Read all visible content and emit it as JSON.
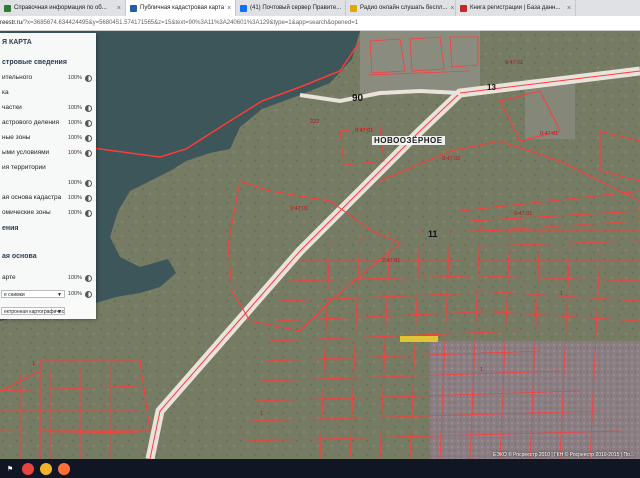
{
  "browser": {
    "tabs": [
      {
        "label": "Справочная информация по об...",
        "active": false,
        "color": "#2e7d32"
      },
      {
        "label": "Публичная кадастровая карта",
        "active": true,
        "color": "#1f5fa8"
      },
      {
        "label": "(41) Почтовый сервер Правите...",
        "active": false,
        "color": "#0d6efd"
      },
      {
        "label": "Радио онлайн слушать беспл...",
        "active": false,
        "color": "#e0a800"
      },
      {
        "label": "Книга регистрации | База данн...",
        "active": false,
        "color": "#c62828"
      }
    ],
    "url_host": "reestr.ru",
    "url_rest": "/?x=3685674.634424495&y=5680451.574171565&z=15&text=90%3A11%3A240601%3A129&type=1&app=search&opened=1"
  },
  "panel": {
    "title": "Я КАРТА",
    "section1": "стровые сведения",
    "layers1": [
      {
        "label": "ительного",
        "value": "100%"
      },
      {
        "label": "ка",
        "value": ""
      },
      {
        "label": "частки",
        "value": "100%"
      },
      {
        "label": "астрового деления",
        "value": "100%"
      },
      {
        "label": "ные зоны",
        "value": "100%"
      },
      {
        "label": "ыми условиями",
        "value": "100%"
      },
      {
        "label": "ия территории",
        "value": ""
      },
      {
        "label": "",
        "value": "100%"
      },
      {
        "label": "ая основа кадастра",
        "value": "100%"
      },
      {
        "label": "омические зоны",
        "value": "100%"
      }
    ],
    "section1_tail": "ения",
    "section2": "ая основа",
    "layers2": [
      {
        "label": "арте",
        "value": "100%"
      }
    ],
    "select1": "е снимки",
    "select1_value": "100%",
    "select2": "ектронная картографичес"
  },
  "map": {
    "village": "НОВООЗЁРНОЕ",
    "road_90": "90",
    "road_13": "13",
    "block_11": "11",
    "parcel_labels": [
      "0:47:01",
      "0:47:02",
      "0:47:01",
      "0:47:01",
      "2:47:01",
      "0:47:01",
      "0:47:01",
      "222",
      "1",
      "1",
      "1",
      "1"
    ],
    "copyright": "ЕЭКО © Росреестр 2010 | ГКН © Росреестр 2010-2015 | По...",
    "colors": {
      "water": "#3d5659",
      "land": "#747a62",
      "parcel": "#ff3b3b",
      "road": "#eae3dc",
      "highlight": "#e0c534"
    }
  },
  "taskbar": {
    "apps": [
      {
        "icon": "flag-icon",
        "color": "#ffffff"
      },
      {
        "icon": "chrome-icon",
        "color": "#e8453c"
      },
      {
        "icon": "folder-icon",
        "color": "#f0b429"
      },
      {
        "icon": "firefox-icon",
        "color": "#ff7139"
      }
    ]
  }
}
